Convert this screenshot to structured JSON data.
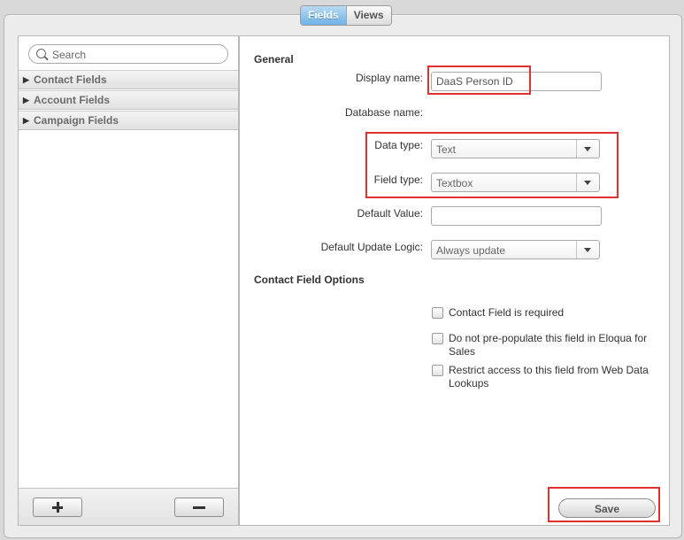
{
  "tabs": [
    {
      "label": "Fields",
      "active": true
    },
    {
      "label": "Views",
      "active": false
    }
  ],
  "search": {
    "placeholder": "Search"
  },
  "groups": [
    {
      "label": "Contact Fields"
    },
    {
      "label": "Account Fields"
    },
    {
      "label": "Campaign Fields"
    }
  ],
  "general": {
    "title": "General",
    "display_name_label": "Display name:",
    "display_name_value": "DaaS Person ID",
    "database_name_label": "Database name:",
    "data_type_label": "Data type:",
    "data_type_value": "Text",
    "field_type_label": "Field type:",
    "field_type_value": "Textbox",
    "default_value_label": "Default Value:",
    "default_value": "",
    "update_logic_label": "Default Update Logic:",
    "update_logic_value": "Always update"
  },
  "options": {
    "title": "Contact Field Options",
    "required_label": "Contact Field is required",
    "prepopulate_label": "Do not pre-populate this field in Eloqua for Sales",
    "restrict_label": "Restrict access to this field from Web Data Lookups"
  },
  "actions": {
    "save_label": "Save"
  },
  "colors": {
    "highlight": "#e03030",
    "tab_active": "#6fb2e6"
  }
}
